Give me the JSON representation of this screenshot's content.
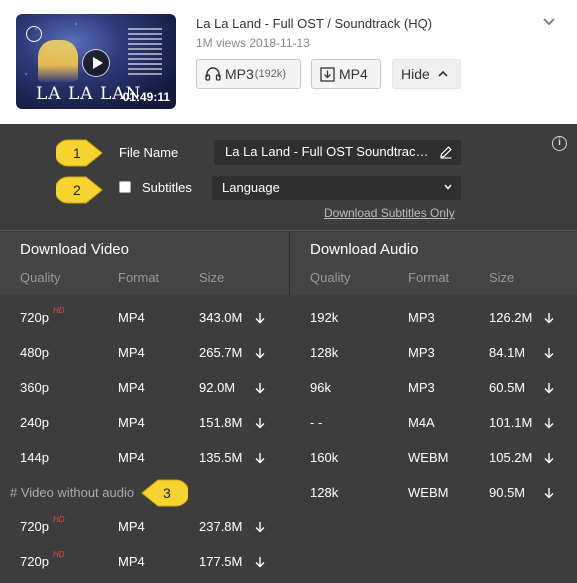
{
  "video": {
    "title": "La La Land - Full OST / Soundtrack (HQ)",
    "meta": "1M views 2018-11-13",
    "duration": "01:49:11",
    "thumbnail_logo": "LA LA LAN"
  },
  "actions": {
    "mp3_label": "MP3",
    "mp3_bitrate": "(192k)",
    "mp4_label": "MP4",
    "hide_label": "Hide"
  },
  "form": {
    "file_name_label": "File Name",
    "file_name_value": "La La Land - Full OST  Soundtrack (HQ)",
    "subtitles_label": "Subtitles",
    "language_value": "Language",
    "download_subtitles_link": "Download Subtitles Only"
  },
  "callouts": [
    "1",
    "2",
    "3"
  ],
  "download_video": {
    "title": "Download Video",
    "columns": [
      "Quality",
      "Format",
      "Size"
    ],
    "rows": [
      {
        "quality": "720p",
        "hd": "HD",
        "format": "MP4",
        "size": "343.0M"
      },
      {
        "quality": "480p",
        "hd": "",
        "format": "MP4",
        "size": "265.7M"
      },
      {
        "quality": "360p",
        "hd": "",
        "format": "MP4",
        "size": "92.0M"
      },
      {
        "quality": "240p",
        "hd": "",
        "format": "MP4",
        "size": "151.8M"
      },
      {
        "quality": "144p",
        "hd": "",
        "format": "MP4",
        "size": "135.5M"
      }
    ],
    "no_audio_label": "# Video without audio",
    "no_audio_rows": [
      {
        "quality": "720p",
        "hd": "HD",
        "format": "MP4",
        "size": "237.8M"
      },
      {
        "quality": "720p",
        "hd": "HD",
        "format": "MP4",
        "size": "177.5M"
      }
    ]
  },
  "download_audio": {
    "title": "Download Audio",
    "columns": [
      "Quality",
      "Format",
      "Size"
    ],
    "rows": [
      {
        "quality": "192k",
        "format": "MP3",
        "size": "126.2M"
      },
      {
        "quality": "128k",
        "format": "MP3",
        "size": "84.1M"
      },
      {
        "quality": "96k",
        "format": "MP3",
        "size": "60.5M"
      },
      {
        "quality": "- -",
        "format": "M4A",
        "size": "101.1M"
      },
      {
        "quality": "160k",
        "format": "WEBM",
        "size": "105.2M"
      },
      {
        "quality": "128k",
        "format": "WEBM",
        "size": "90.5M"
      }
    ]
  },
  "colors": {
    "panel_bg": "#3d3d3d",
    "callout_yellow": "#f6d32e",
    "hd_badge": "#e8453c"
  },
  "icons": [
    "headphones-icon",
    "download-box-icon",
    "chevron-up-icon",
    "chevron-down-icon",
    "info-icon",
    "pencil-icon",
    "download-arrow-icon"
  ]
}
